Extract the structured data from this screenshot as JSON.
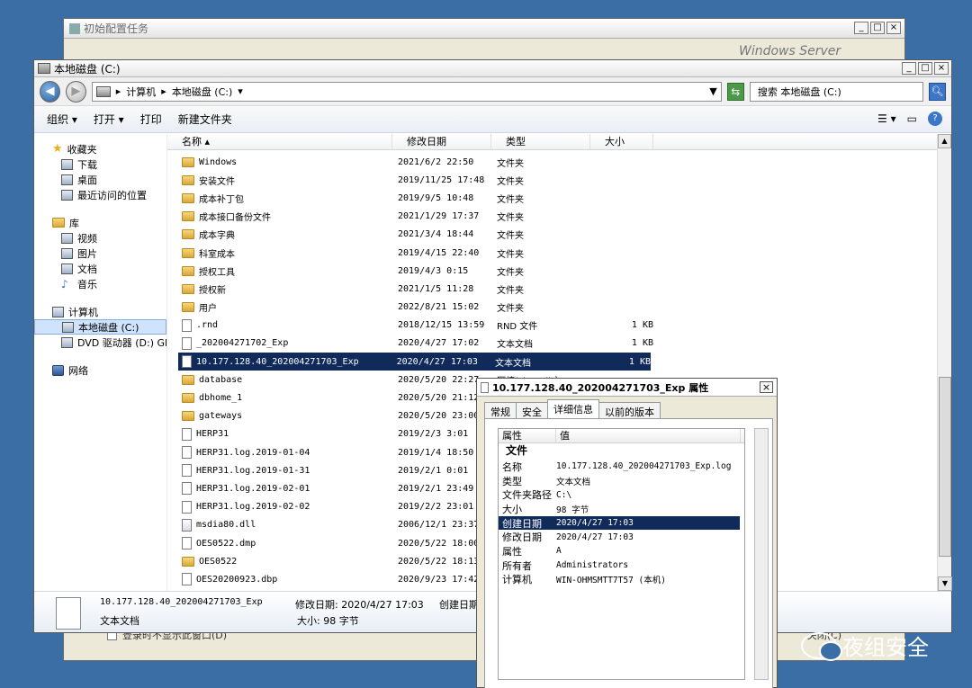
{
  "bg_window": {
    "title": "初始配置任务",
    "bottom_text": "登录时不显示此窗口(D)",
    "bottom_right": "关闭(C)",
    "banner": "Windows Server"
  },
  "explorer": {
    "title": "本地磁盘 (C:)",
    "address": [
      "计算机",
      "本地磁盘 (C:)"
    ],
    "search_placeholder": "搜索 本地磁盘 (C:)",
    "commands": {
      "organize": "组织 ▾",
      "open": "打开 ▾",
      "print": "打印",
      "new_folder": "新建文件夹"
    },
    "nav": {
      "favorites": {
        "label": "收藏夹",
        "items": [
          "下载",
          "桌面",
          "最近访问的位置"
        ]
      },
      "libraries": {
        "label": "库",
        "items": [
          "视频",
          "图片",
          "文档",
          "音乐"
        ]
      },
      "computer": {
        "label": "计算机",
        "items": [
          "本地磁盘 (C:)",
          "DVD 驱动器 (D:) GR"
        ]
      },
      "network": {
        "label": "网络"
      }
    },
    "columns": {
      "name": "名称",
      "modified": "修改日期",
      "type": "类型",
      "size": "大小"
    },
    "files": [
      {
        "name": "Windows",
        "date": "2021/6/2 22:50",
        "type": "文件夹",
        "size": "",
        "icon": "folder"
      },
      {
        "name": "安装文件",
        "date": "2019/11/25 17:48",
        "type": "文件夹",
        "size": "",
        "icon": "folder"
      },
      {
        "name": "成本补丁包",
        "date": "2019/9/5 10:48",
        "type": "文件夹",
        "size": "",
        "icon": "folder"
      },
      {
        "name": "成本接口备份文件",
        "date": "2021/1/29 17:37",
        "type": "文件夹",
        "size": "",
        "icon": "folder"
      },
      {
        "name": "成本字典",
        "date": "2021/3/4 18:44",
        "type": "文件夹",
        "size": "",
        "icon": "folder"
      },
      {
        "name": "科室成本",
        "date": "2019/4/15 22:40",
        "type": "文件夹",
        "size": "",
        "icon": "folder"
      },
      {
        "name": "授权工具",
        "date": "2019/4/3 0:15",
        "type": "文件夹",
        "size": "",
        "icon": "folder"
      },
      {
        "name": "授权新",
        "date": "2021/1/5 11:28",
        "type": "文件夹",
        "size": "",
        "icon": "folder"
      },
      {
        "name": "用户",
        "date": "2022/8/21 15:02",
        "type": "文件夹",
        "size": "",
        "icon": "folder"
      },
      {
        "name": ".rnd",
        "date": "2018/12/15 13:59",
        "type": "RND 文件",
        "size": "1 KB",
        "icon": "doc"
      },
      {
        "name": "_202004271702_Exp",
        "date": "2020/4/27 17:02",
        "type": "文本文档",
        "size": "1 KB",
        "icon": "doc"
      },
      {
        "name": "10.177.128.40_202004271703_Exp",
        "date": "2020/4/27 17:03",
        "type": "文本文档",
        "size": "1 KB",
        "icon": "doc",
        "selected": true
      },
      {
        "name": "database",
        "date": "2020/5/20 22:27",
        "type": "压缩(zipped)文",
        "size": "",
        "icon": "folder"
      },
      {
        "name": "dbhome_1",
        "date": "2020/5/20 21:12",
        "type": "",
        "size": "",
        "icon": "folder"
      },
      {
        "name": "gateways",
        "date": "2020/5/20 23:00",
        "type": "",
        "size": "",
        "icon": "folder"
      },
      {
        "name": "HERP31",
        "date": "2019/2/3 3:01",
        "type": "",
        "size": "",
        "icon": "doc"
      },
      {
        "name": "HERP31.log.2019-01-04",
        "date": "2019/1/4 18:50",
        "type": "",
        "size": "",
        "icon": "doc"
      },
      {
        "name": "HERP31.log.2019-01-31",
        "date": "2019/2/1 0:01",
        "type": "",
        "size": "",
        "icon": "doc"
      },
      {
        "name": "HERP31.log.2019-02-01",
        "date": "2019/2/1 23:49",
        "type": "",
        "size": "",
        "icon": "doc"
      },
      {
        "name": "HERP31.log.2019-02-02",
        "date": "2019/2/2 23:01",
        "type": "",
        "size": "",
        "icon": "doc"
      },
      {
        "name": "msdia80.dll",
        "date": "2006/12/1 23:37",
        "type": "",
        "size": "",
        "icon": "dll"
      },
      {
        "name": "OES0522.dmp",
        "date": "2020/5/22 18:00",
        "type": "",
        "size": "",
        "icon": "doc"
      },
      {
        "name": "OES0522",
        "date": "2020/5/22 18:13",
        "type": "",
        "size": "",
        "icon": "folder"
      },
      {
        "name": "OES20200923.dbp",
        "date": "2020/9/23 17:42",
        "type": "",
        "size": "",
        "icon": "doc"
      }
    ],
    "details": {
      "name": "10.177.128.40_202004271703_Exp",
      "modified": "修改日期: 2020/4/27 17:03",
      "type": "文本文档",
      "size": "大小: 98 字节",
      "created": "创建日期"
    }
  },
  "prop_dialog": {
    "title": "10.177.128.40_202004271703_Exp 属性",
    "tabs": [
      "常规",
      "安全",
      "详细信息",
      "以前的版本"
    ],
    "active_tab": 2,
    "header": {
      "key": "属性",
      "value": "值"
    },
    "group": "文件",
    "rows": [
      {
        "k": "名称",
        "v": "10.177.128.40_202004271703_Exp.log"
      },
      {
        "k": "类型",
        "v": "文本文档"
      },
      {
        "k": "文件夹路径",
        "v": "C:\\"
      },
      {
        "k": "大小",
        "v": "98 字节"
      },
      {
        "k": "创建日期",
        "v": "2020/4/27 17:03",
        "selected": true
      },
      {
        "k": "修改日期",
        "v": "2020/4/27 17:03"
      },
      {
        "k": "属性",
        "v": "A"
      },
      {
        "k": "所有者",
        "v": "Administrators"
      },
      {
        "k": "计算机",
        "v": "WIN-OHMSMTT7T57 (本机)"
      }
    ]
  },
  "watermark": "夜组安全"
}
